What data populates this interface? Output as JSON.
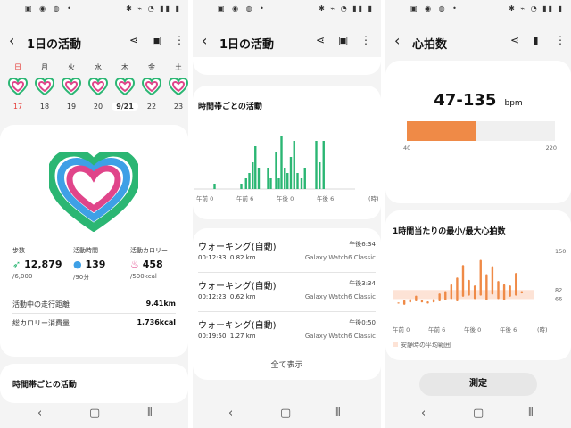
{
  "status": {
    "left": "▣ ◉ ◍ •",
    "right": "✱ ⌁ ◔ ▮▮ ▮"
  },
  "screen1": {
    "title": "1日の活動",
    "week": [
      {
        "name": "日",
        "date": "17",
        "color": "#e53935"
      },
      {
        "name": "月",
        "date": "18",
        "color": "#333333"
      },
      {
        "name": "火",
        "date": "19",
        "color": "#333333"
      },
      {
        "name": "水",
        "date": "20",
        "color": "#333333"
      },
      {
        "name": "木",
        "date": "9/21",
        "color": "#333333"
      },
      {
        "name": "金",
        "date": "22",
        "color": "#333333"
      },
      {
        "name": "土",
        "date": "23",
        "color": "#333333"
      }
    ],
    "steps": {
      "label": "歩数",
      "value": "12,879",
      "goal": "/6,000"
    },
    "active_time": {
      "label": "活動時間",
      "value": "139",
      "goal": "/90分"
    },
    "calories": {
      "label": "活動カロリー",
      "value": "458",
      "goal": "/500kcal"
    },
    "distance": {
      "label": "活動中の走行距離",
      "value": "9.41km"
    },
    "total_cal": {
      "label": "総カロリー消費量",
      "value": "1,736kcal"
    },
    "hourly_title": "時間帯ごとの活動",
    "colors": {
      "steps": "#2bb673",
      "time": "#3ea0e6",
      "cal": "#e0458a"
    }
  },
  "screen2": {
    "title": "1日の活動",
    "hourly_title": "時間帯ごとの活動",
    "x_labels": [
      "午前 0",
      "午前 6",
      "午後 0",
      "午後 6",
      "(時)"
    ],
    "bars": [
      {
        "hour": 3.0,
        "value": 0.1
      },
      {
        "hour": 7.0,
        "value": 0.1
      },
      {
        "hour": 7.7,
        "value": 0.2
      },
      {
        "hour": 8.2,
        "value": 0.3
      },
      {
        "hour": 8.7,
        "value": 0.5
      },
      {
        "hour": 9.1,
        "value": 0.8
      },
      {
        "hour": 9.6,
        "value": 0.4
      },
      {
        "hour": 11.0,
        "value": 0.4
      },
      {
        "hour": 11.4,
        "value": 0.2
      },
      {
        "hour": 12.2,
        "value": 0.7
      },
      {
        "hour": 12.6,
        "value": 0.2
      },
      {
        "hour": 13.0,
        "value": 1.0
      },
      {
        "hour": 13.5,
        "value": 0.4
      },
      {
        "hour": 13.9,
        "value": 0.3
      },
      {
        "hour": 14.4,
        "value": 0.6
      },
      {
        "hour": 14.9,
        "value": 0.9
      },
      {
        "hour": 15.4,
        "value": 0.3
      },
      {
        "hour": 16.0,
        "value": 0.2
      },
      {
        "hour": 16.5,
        "value": 0.4
      },
      {
        "hour": 18.2,
        "value": 0.9
      },
      {
        "hour": 18.7,
        "value": 0.5
      },
      {
        "hour": 19.3,
        "value": 0.9
      }
    ],
    "workouts": [
      {
        "name": "ウォーキング(自動)",
        "time": "午後6:34",
        "duration": "00:12:33",
        "distance": "0.82 km",
        "device": "Galaxy Watch6 Classic"
      },
      {
        "name": "ウォーキング(自動)",
        "time": "午後3:34",
        "duration": "00:12:23",
        "distance": "0.62 km",
        "device": "Galaxy Watch6 Classic"
      },
      {
        "name": "ウォーキング(自動)",
        "time": "午後0:50",
        "duration": "00:19:50",
        "distance": "1.27 km",
        "device": "Galaxy Watch6 Classic"
      }
    ],
    "show_all": "全て表示",
    "bar_color": "#2bb673"
  },
  "screen3": {
    "title": "心拍数",
    "range_value": "47-135",
    "unit": "bpm",
    "scale_min": "40",
    "scale_max": "220",
    "fill_fraction": 0.47,
    "chart_title": "1時間当たりの最小/最大心拍数",
    "y_labels": [
      "150",
      "82",
      "66"
    ],
    "x_labels": [
      "午前 0",
      "午前 6",
      "午後 0",
      "午後 6",
      "(時)"
    ],
    "legend": "安静時の平均範囲",
    "measure_button": "測定",
    "accent": "#ef8a47",
    "rest_band": "#fde3d6"
  }
}
